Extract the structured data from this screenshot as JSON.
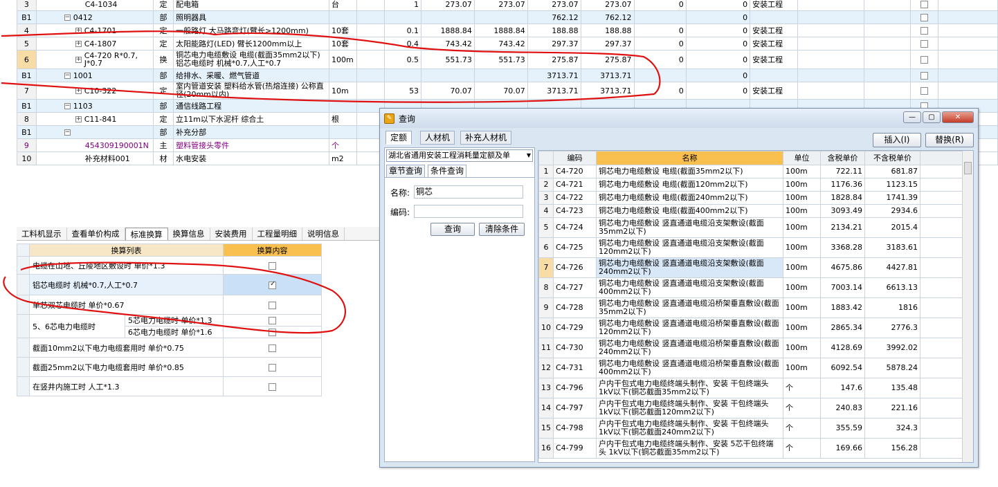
{
  "main_rows": [
    {
      "rn": "3",
      "sec": false,
      "code": "C4-1034",
      "type": "定",
      "name": "配电箱",
      "unit": "台",
      "qty": "1",
      "p1": "273.07",
      "p2": "273.07",
      "p3": "273.07",
      "p4": "273.07",
      "z1": "0",
      "z2": "0",
      "cat": "安装工程",
      "tree": ""
    },
    {
      "rn": "B1",
      "sec": true,
      "code": "0412",
      "type": "部",
      "name": "照明器具",
      "unit": "",
      "qty": "",
      "p1": "",
      "p2": "",
      "p3": "762.12",
      "p4": "762.12",
      "z1": "",
      "z2": "0",
      "cat": "",
      "tree": "−"
    },
    {
      "rn": "4",
      "sec": false,
      "code": "C4-1701",
      "type": "定",
      "name": "一般路灯 大马路弯灯(臂长>1200mm)",
      "unit": "10套",
      "qty": "0.1",
      "p1": "1888.84",
      "p2": "1888.84",
      "p3": "188.88",
      "p4": "188.88",
      "z1": "0",
      "z2": "0",
      "cat": "安装工程",
      "tree": "+"
    },
    {
      "rn": "5",
      "sec": false,
      "code": "C4-1807",
      "type": "定",
      "name": "太阳能路灯(LED) 臂长1200mm以上",
      "unit": "10套",
      "qty": "0.4",
      "p1": "743.42",
      "p2": "743.42",
      "p3": "297.37",
      "p4": "297.37",
      "z1": "0",
      "z2": "0",
      "cat": "安装工程",
      "tree": "+"
    },
    {
      "rn": "6",
      "sec": false,
      "sel": true,
      "code": "C4-720 R*0.7, J*0.7",
      "type": "换",
      "name": "铜芯电力电缆敷设 电缆(截面35mm2以下) 铝芯电缆时 机械*0.7,人工*0.7",
      "unit": "100m",
      "qty": "0.5",
      "p1": "551.73",
      "p2": "551.73",
      "p3": "275.87",
      "p4": "275.87",
      "z1": "0",
      "z2": "0",
      "cat": "安装工程",
      "tree": "+"
    },
    {
      "rn": "B1",
      "sec": true,
      "code": "1001",
      "type": "部",
      "name": "给排水、采暖、燃气管道",
      "unit": "",
      "qty": "",
      "p1": "",
      "p2": "",
      "p3": "3713.71",
      "p4": "3713.71",
      "z1": "",
      "z2": "0",
      "cat": "",
      "tree": "−"
    },
    {
      "rn": "7",
      "sec": false,
      "code": "C10-322",
      "type": "定",
      "name": "室内管道安装 塑料给水管(热熔连接) 公称直径(20mm以内)",
      "unit": "10m",
      "qty": "53",
      "p1": "70.07",
      "p2": "70.07",
      "p3": "3713.71",
      "p4": "3713.71",
      "z1": "0",
      "z2": "0",
      "cat": "安装工程",
      "tree": "+"
    },
    {
      "rn": "B1",
      "sec": true,
      "code": "1103",
      "type": "部",
      "name": "通信线路工程",
      "unit": "",
      "qty": "",
      "p1": "",
      "p2": "",
      "p3": "",
      "p4": "",
      "z1": "",
      "z2": "",
      "cat": "",
      "tree": "−"
    },
    {
      "rn": "8",
      "sec": false,
      "code": "C11-841",
      "type": "定",
      "name": "立11m以下水泥杆 综合土",
      "unit": "根",
      "qty": "",
      "p1": "",
      "p2": "",
      "p3": "",
      "p4": "",
      "z1": "",
      "z2": "",
      "cat": "",
      "tree": "+"
    },
    {
      "rn": "B1",
      "sec": true,
      "code": "",
      "type": "部",
      "name": "补充分部",
      "unit": "",
      "qty": "",
      "p1": "",
      "p2": "",
      "p3": "",
      "p4": "",
      "z1": "",
      "z2": "",
      "cat": "",
      "tree": "−"
    },
    {
      "rn": "9",
      "sec": false,
      "purple": true,
      "code": "454309190001N",
      "type": "主",
      "name": "塑料管接头零件",
      "unit": "个",
      "qty": "",
      "p1": "",
      "p2": "",
      "p3": "",
      "p4": "",
      "z1": "",
      "z2": "",
      "cat": "",
      "tree": ""
    },
    {
      "rn": "10",
      "sec": false,
      "code": "补充材料001",
      "type": "材",
      "name": "水电安装",
      "unit": "m2",
      "qty": "",
      "p1": "",
      "p2": "",
      "p3": "",
      "p4": "",
      "z1": "",
      "z2": "",
      "cat": "",
      "tree": ""
    }
  ],
  "bottom_tabs": [
    "工料机显示",
    "查看单价构成",
    "标准换算",
    "换算信息",
    "安装费用",
    "工程量明细",
    "说明信息"
  ],
  "bottom_active_tab": 2,
  "calc": {
    "header_list": "换算列表",
    "header_content": "换算内容",
    "rows": [
      {
        "label": "电缆在山地、丘陵地区敷设时 单价*1.3",
        "checked": false
      },
      {
        "label": "铝芯电缆时 机械*0.7,人工*0.7",
        "checked": true,
        "hl": true
      },
      {
        "label": "单芯双芯电缆时 单价*0.67",
        "checked": false
      }
    ],
    "group_label": "5、6芯电力电缆时",
    "group_items": [
      {
        "label": "5芯电力电缆时 单价*1.3",
        "checked": false
      },
      {
        "label": "6芯电力电缆时 单价*1.6",
        "checked": false
      }
    ],
    "rows2": [
      {
        "label": "截面10mm2以下电力电缆套用时 单价*0.75",
        "checked": false
      },
      {
        "label": "截面25mm2以下电力电缆套用时 单价*0.85",
        "checked": false
      },
      {
        "label": "在竖井内施工时 人工*1.3",
        "checked": false
      }
    ]
  },
  "dialog": {
    "title": "查询",
    "tabs": [
      "定额",
      "人材机",
      "补充人材机"
    ],
    "insert_btn": "插入(I)",
    "replace_btn": "替换(R)",
    "library": "湖北省通用安装工程消耗量定额及单",
    "subtabs": [
      "章节查询",
      "条件查询"
    ],
    "name_label": "名称:",
    "name_value": "铜芯",
    "code_label": "编码:",
    "code_value": "",
    "query_btn": "查询",
    "clear_btn": "清除条件",
    "headers": [
      "编码",
      "名称",
      "单位",
      "含税单价",
      "不含税单价"
    ],
    "rows": [
      {
        "i": "1",
        "code": "C4-720",
        "name": "铜芯电力电缆敷设 电缆(截面35mm2以下)",
        "unit": "100m",
        "p1": "722.11",
        "p2": "681.87"
      },
      {
        "i": "2",
        "code": "C4-721",
        "name": "铜芯电力电缆敷设 电缆(截面120mm2以下)",
        "unit": "100m",
        "p1": "1176.36",
        "p2": "1123.15"
      },
      {
        "i": "3",
        "code": "C4-722",
        "name": "铜芯电力电缆敷设 电缆(截面240mm2以下)",
        "unit": "100m",
        "p1": "1828.84",
        "p2": "1741.39"
      },
      {
        "i": "4",
        "code": "C4-723",
        "name": "铜芯电力电缆敷设 电缆(截面400mm2以下)",
        "unit": "100m",
        "p1": "3093.49",
        "p2": "2934.6"
      },
      {
        "i": "5",
        "code": "C4-724",
        "name": "铜芯电力电缆敷设 竖直通道电缆沿支架敷设(截面35mm2以下)",
        "unit": "100m",
        "p1": "2134.21",
        "p2": "2015.4"
      },
      {
        "i": "6",
        "code": "C4-725",
        "name": "铜芯电力电缆敷设 竖直通道电缆沿支架敷设(截面120mm2以下)",
        "unit": "100m",
        "p1": "3368.28",
        "p2": "3183.61"
      },
      {
        "i": "7",
        "code": "C4-726",
        "name": "铜芯电力电缆敷设 竖直通道电缆沿支架敷设(截面240mm2以下)",
        "unit": "100m",
        "p1": "4675.86",
        "p2": "4427.81",
        "sel": true
      },
      {
        "i": "8",
        "code": "C4-727",
        "name": "铜芯电力电缆敷设 竖直通道电缆沿支架敷设(截面400mm2以下)",
        "unit": "100m",
        "p1": "7003.14",
        "p2": "6613.13"
      },
      {
        "i": "9",
        "code": "C4-728",
        "name": "铜芯电力电缆敷设 竖直通道电缆沿桥架垂直敷设(截面35mm2以下)",
        "unit": "100m",
        "p1": "1883.42",
        "p2": "1816"
      },
      {
        "i": "10",
        "code": "C4-729",
        "name": "铜芯电力电缆敷设 竖直通道电缆沿桥架垂直敷设(截面120mm2以下)",
        "unit": "100m",
        "p1": "2865.34",
        "p2": "2776.3"
      },
      {
        "i": "11",
        "code": "C4-730",
        "name": "铜芯电力电缆敷设 竖直通道电缆沿桥架垂直敷设(截面240mm2以下)",
        "unit": "100m",
        "p1": "4128.69",
        "p2": "3992.02"
      },
      {
        "i": "12",
        "code": "C4-731",
        "name": "铜芯电力电缆敷设 竖直通道电缆沿桥架垂直敷设(截面400mm2以下)",
        "unit": "100m",
        "p1": "6092.54",
        "p2": "5878.24"
      },
      {
        "i": "13",
        "code": "C4-796",
        "name": "户内干包式电力电缆终端头制作、安装 干包终端头 1kV以下(铜芯截面35mm2以下)",
        "unit": "个",
        "p1": "147.6",
        "p2": "135.48"
      },
      {
        "i": "14",
        "code": "C4-797",
        "name": "户内干包式电力电缆终端头制作、安装 干包终端头 1kV以下(铜芯截面120mm2以下)",
        "unit": "个",
        "p1": "240.83",
        "p2": "221.16"
      },
      {
        "i": "15",
        "code": "C4-798",
        "name": "户内干包式电力电缆终端头制作、安装 干包终端头 1kV以下(铜芯截面240mm2以下)",
        "unit": "个",
        "p1": "355.59",
        "p2": "324.3"
      },
      {
        "i": "16",
        "code": "C4-799",
        "name": "户内干包式电力电缆终端头制作、安装 5芯干包终端头 1kV以下(铜芯截面35mm2以下)",
        "unit": "个",
        "p1": "169.66",
        "p2": "156.28"
      }
    ]
  },
  "colors": {
    "accent_header": "#f9bf4f",
    "selection": "#f8dca5",
    "annotation": "#e01010"
  }
}
